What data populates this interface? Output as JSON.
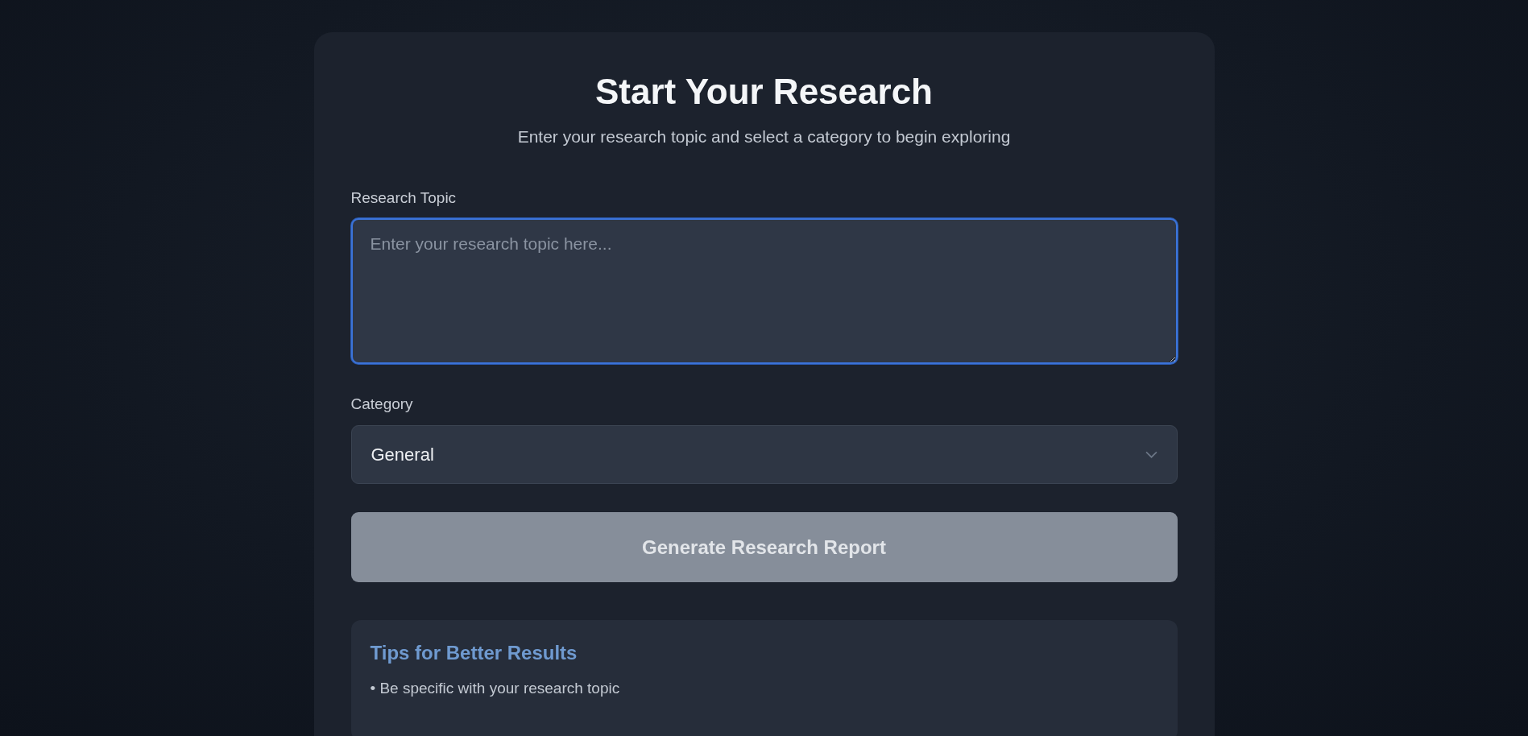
{
  "card": {
    "title": "Start Your Research",
    "subtitle": "Enter your research topic and select a category to begin exploring",
    "topic_field": {
      "label": "Research Topic",
      "placeholder": "Enter your research topic here...",
      "focused": true
    },
    "category_field": {
      "label": "Category",
      "value": "General"
    },
    "generate_button": {
      "label": "Generate Research Report",
      "disabled": true
    },
    "tips": {
      "title": "Tips for Better Results",
      "items": [
        "• Be specific with your research topic"
      ]
    }
  }
}
